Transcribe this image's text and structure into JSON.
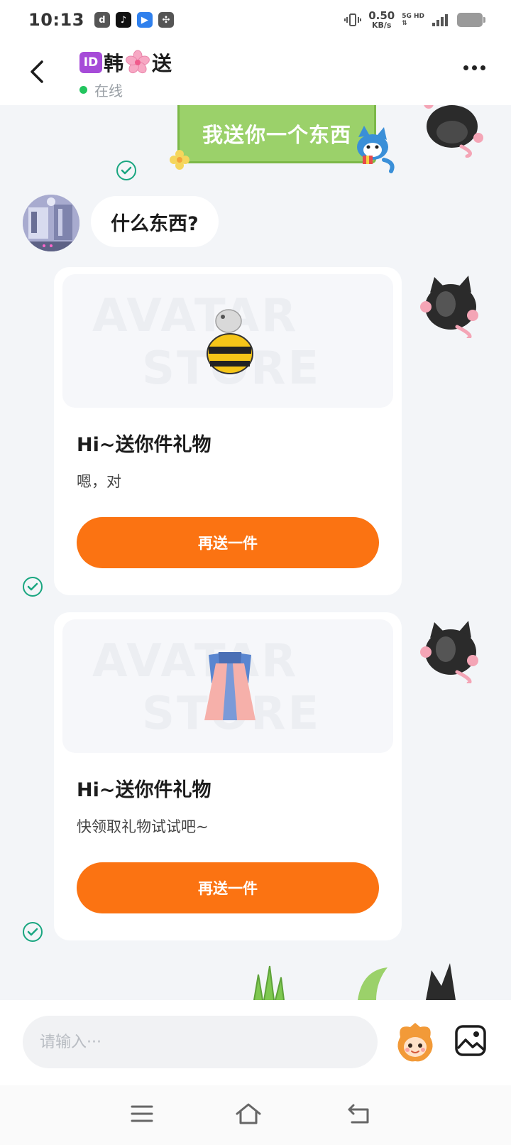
{
  "status_bar": {
    "time": "10:13",
    "net_speed_value": "0.50",
    "net_speed_unit": "KB/s",
    "net_type_1": "5G HD",
    "net_type_2": "⇅"
  },
  "header": {
    "id_badge": "ID",
    "name_part1": "韩",
    "name_part2": "送",
    "status": "在线"
  },
  "messages": {
    "sticker_text": "我送你一个东西",
    "left_text": "什么东西?",
    "gift_cards": [
      {
        "title": "Hi~送你件礼物",
        "description": "嗯，对",
        "button": "再送一件"
      },
      {
        "title": "Hi~送你件礼物",
        "description": "快领取礼物试试吧~",
        "button": "再送一件"
      }
    ],
    "watermark_line1": "AVATAR",
    "watermark_line2": "STORE"
  },
  "input_bar": {
    "placeholder": "请输入···"
  },
  "colors": {
    "accent_orange": "#fb7312",
    "online_green": "#22c55e",
    "check_green": "#19a680",
    "sticker_green": "#9bd16a"
  },
  "icons": [
    "back-arrow-icon",
    "more-dots-icon",
    "check-icon",
    "avatar-face-icon",
    "image-icon",
    "menu-icon",
    "home-icon",
    "back-nav-icon"
  ]
}
